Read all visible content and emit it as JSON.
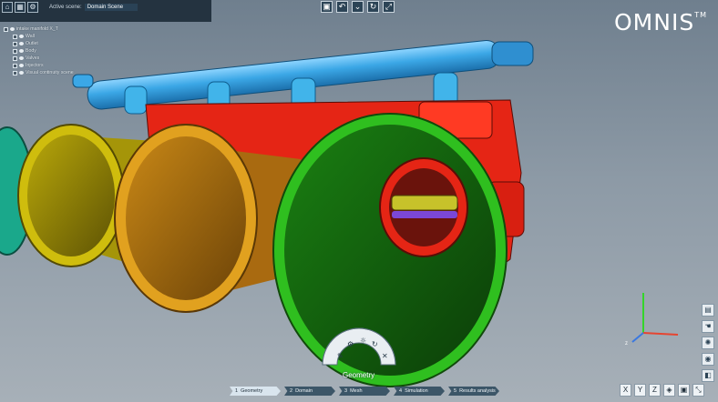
{
  "toolbar": {
    "active_scene_label": "Active scene:",
    "active_scene_value": "Domain Scene"
  },
  "tree": {
    "root": "intake manifold X_T",
    "items": [
      "Wall",
      "Outlet",
      "Body",
      "Valves",
      "Injectors",
      "Visual continuity scene"
    ]
  },
  "brand": {
    "name": "OMNIS",
    "mark": "TM"
  },
  "radial": {
    "mode_label": "Geometry"
  },
  "wizard": {
    "steps": [
      {
        "label": "Geometry",
        "state": "active"
      },
      {
        "label": "Domain",
        "state": "pending"
      },
      {
        "label": "Mesh",
        "state": "pending"
      },
      {
        "label": "Simulation",
        "state": "pending"
      },
      {
        "label": "Results analysis",
        "state": "pending"
      }
    ]
  },
  "view_axes": {
    "x": "X",
    "y": "Y",
    "z": "Z"
  },
  "colors": {
    "rail": "#3ba7e6",
    "bell_cyan": "#20c7a4",
    "bell_yellow": "#d8c40d",
    "bell_orange": "#e1a11f",
    "bell_green": "#2fbf1f",
    "body_red": "#e52515",
    "injector": "#41b4ea",
    "background_top": "#6f7f8e",
    "background_bottom": "#a7b0b8"
  }
}
